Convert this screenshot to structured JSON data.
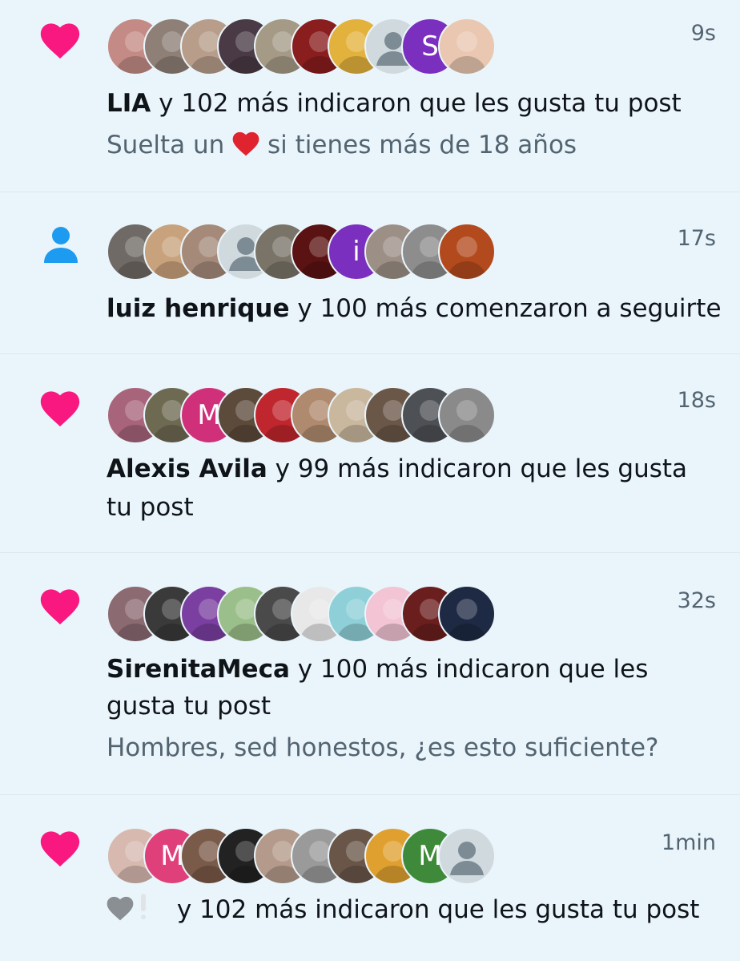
{
  "notifications": [
    {
      "type": "like",
      "icon": "heart-icon",
      "time": "9s",
      "name": "LIA",
      "text": " y 102 más indicaron que les gusta tu post",
      "sub_before": "Suelta un ",
      "sub_after": " si tienes más de 18 años",
      "avatars": [
        {
          "color": "#c48b86"
        },
        {
          "color": "#8e7f77"
        },
        {
          "color": "#b79d8a"
        },
        {
          "color": "#4a3a45"
        },
        {
          "color": "#a59a86"
        },
        {
          "color": "#8a1d1d"
        },
        {
          "color": "#e3b23c"
        },
        {
          "color": "#cfd9de",
          "placeholder": true
        },
        {
          "color": "#7b2fbe",
          "letter": "S"
        },
        {
          "color": "#e9c7b1"
        }
      ]
    },
    {
      "type": "follow",
      "icon": "person-icon",
      "time": "17s",
      "name": "luiz henrique",
      "text": " y 100 más comenzaron a seguirte",
      "avatars": [
        {
          "color": "#6f6a65"
        },
        {
          "color": "#c8a27c"
        },
        {
          "color": "#a58a7a"
        },
        {
          "color": "#cfd9de",
          "placeholder": true
        },
        {
          "color": "#7a7468"
        },
        {
          "color": "#5b1212"
        },
        {
          "color": "#7b2fbe",
          "letter": "i"
        },
        {
          "color": "#9c8f86"
        },
        {
          "color": "#8d8d8d"
        },
        {
          "color": "#b24a1e"
        }
      ]
    },
    {
      "type": "like",
      "icon": "heart-icon",
      "time": "18s",
      "name": "Alexis Avila",
      "text": " y 99 más indicaron que les gusta",
      "text2": "tu post",
      "avatars": [
        {
          "color": "#a8647a"
        },
        {
          "color": "#6e6a52"
        },
        {
          "color": "#d0307a",
          "letter": "M"
        },
        {
          "color": "#5c4a3a"
        },
        {
          "color": "#c0262d"
        },
        {
          "color": "#b08a6e"
        },
        {
          "color": "#c9b79e"
        },
        {
          "color": "#6b5748"
        },
        {
          "color": "#4d5055"
        },
        {
          "color": "#8a8a8a"
        }
      ]
    },
    {
      "type": "like",
      "icon": "heart-icon",
      "time": "32s",
      "name": "SirenitaMeca",
      "text": " y 100 más indicaron que les",
      "text2": "gusta tu post",
      "sub": "Hombres, sed honestos, ¿es esto suficiente?",
      "avatars": [
        {
          "color": "#8c6a72"
        },
        {
          "color": "#3a3a3a"
        },
        {
          "color": "#7a3fa0"
        },
        {
          "color": "#9bbf8a"
        },
        {
          "color": "#4a4a4a"
        },
        {
          "color": "#e8e8e8"
        },
        {
          "color": "#8fd0d8"
        },
        {
          "color": "#f2c4d4"
        },
        {
          "color": "#6b1e1e"
        },
        {
          "color": "#1e2a44"
        }
      ]
    },
    {
      "type": "like",
      "icon": "heart-icon",
      "time": "1min",
      "name_prefix": "🩶❕",
      "text": " y 102 más indicaron que les gusta tu post",
      "avatars": [
        {
          "color": "#d7b9b0"
        },
        {
          "color": "#e0407a",
          "letter": "M"
        },
        {
          "color": "#7a5a48"
        },
        {
          "color": "#222222"
        },
        {
          "color": "#b49a8a"
        },
        {
          "color": "#9a9a9a"
        },
        {
          "color": "#6a5648"
        },
        {
          "color": "#e0a030"
        },
        {
          "color": "#3f8a3a",
          "letter": "M"
        },
        {
          "color": "#cfd9de",
          "placeholder": true
        }
      ]
    }
  ],
  "colors": {
    "heart": "#f91880",
    "follow": "#1d9bf0",
    "muted": "#536471",
    "background": "#eaf5fb"
  }
}
